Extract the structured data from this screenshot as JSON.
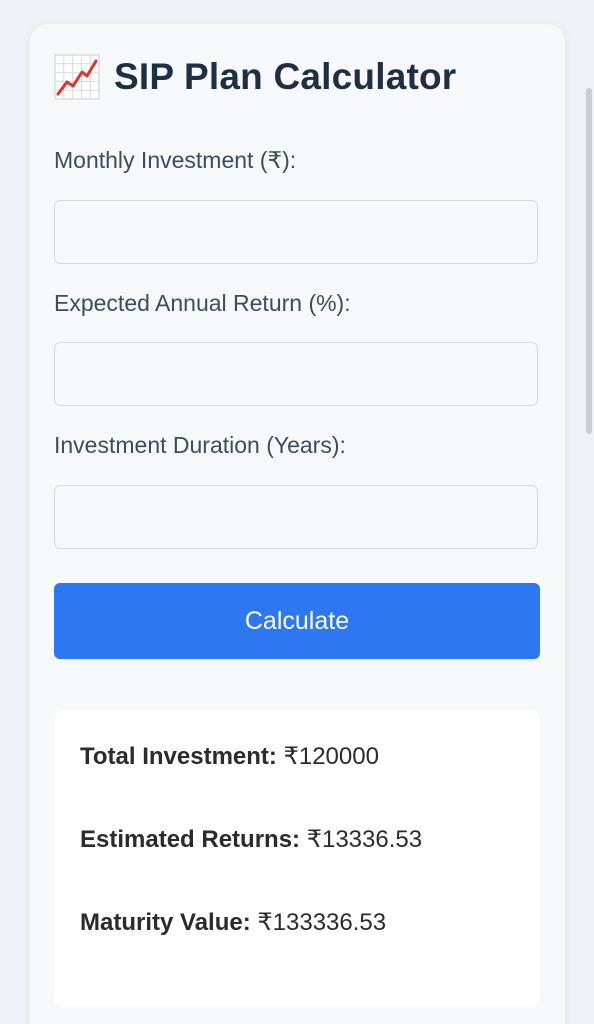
{
  "header": {
    "title": "SIP Plan Calculator",
    "title_icon": "chart-increasing-icon"
  },
  "form": {
    "monthly_investment": {
      "label": "Monthly Investment (₹):",
      "value": ""
    },
    "annual_return": {
      "label": "Expected Annual Return (%):",
      "value": ""
    },
    "duration": {
      "label": "Investment Duration (Years):",
      "value": ""
    },
    "calculate_label": "Calculate"
  },
  "results": {
    "total_investment": {
      "label": "Total Investment:",
      "value": "₹120000"
    },
    "estimated_returns": {
      "label": "Estimated Returns:",
      "value": "₹13336.53"
    },
    "maturity_value": {
      "label": "Maturity Value:",
      "value": "₹133336.53"
    }
  },
  "colors": {
    "accent": "#2d78f2",
    "title": "#1f2f43",
    "label": "#3e4d5d",
    "card_bg": "#f7f8fa",
    "result_bg": "#ffffff"
  }
}
